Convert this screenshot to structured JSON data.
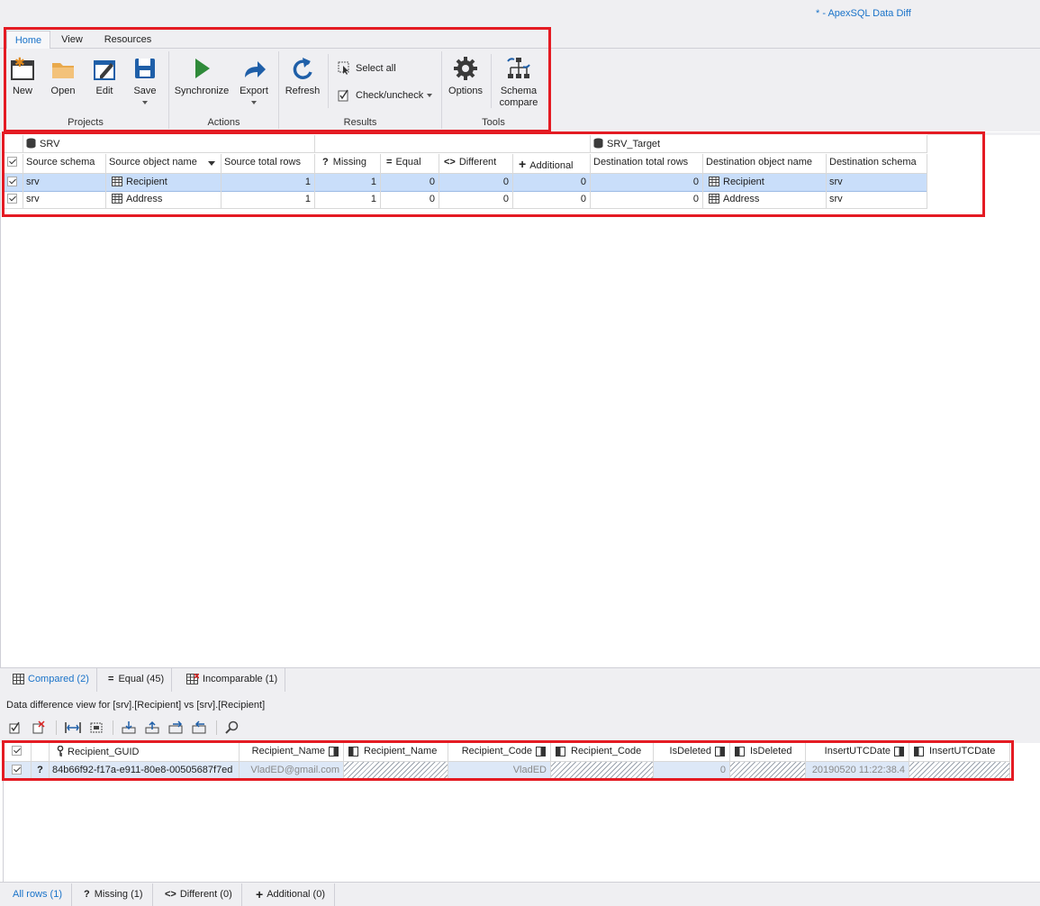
{
  "app": {
    "title": "* - ApexSQL Data Diff"
  },
  "ribbon": {
    "tabs": [
      "Home",
      "View",
      "Resources"
    ],
    "buttons": {
      "new": "New",
      "open": "Open",
      "edit": "Edit",
      "save": "Save",
      "synchronize": "Synchronize",
      "export": "Export",
      "refresh": "Refresh",
      "select_all": "Select all",
      "check_uncheck": "Check/uncheck",
      "options": "Options",
      "schema_compare_1": "Schema",
      "schema_compare_2": "compare"
    },
    "groups": {
      "projects": "Projects",
      "actions": "Actions",
      "results": "Results",
      "tools": "Tools"
    }
  },
  "results_grid": {
    "source_db": "SRV",
    "target_db": "SRV_Target",
    "headers": {
      "source_schema": "Source schema",
      "source_object_name": "Source object name",
      "source_total_rows": "Source total rows",
      "missing": "Missing",
      "equal": "Equal",
      "different": "Different",
      "additional": "Additional",
      "destination_total_rows": "Destination total rows",
      "destination_object_name": "Destination object name",
      "destination_schema": "Destination schema"
    },
    "rows": [
      {
        "source_schema": "srv",
        "source_object": "Recipient",
        "source_total": "1",
        "missing": "1",
        "equal": "0",
        "different": "0",
        "additional": "0",
        "dest_total": "0",
        "dest_object": "Recipient",
        "dest_schema": "srv"
      },
      {
        "source_schema": "srv",
        "source_object": "Address",
        "source_total": "1",
        "missing": "1",
        "equal": "0",
        "different": "0",
        "additional": "0",
        "dest_total": "0",
        "dest_object": "Address",
        "dest_schema": "srv"
      }
    ]
  },
  "result_tabs": {
    "compared": "Compared (2)",
    "equal": "Equal (45)",
    "incomparable": "Incomparable (1)"
  },
  "data_diff": {
    "caption": "Data difference view for [srv].[Recipient] vs [srv].[Recipient]",
    "headers": {
      "guid": "Recipient_GUID",
      "name_src": "Recipient_Name",
      "name_dst": "Recipient_Name",
      "code_src": "Recipient_Code",
      "code_dst": "Recipient_Code",
      "deleted_src": "IsDeleted",
      "deleted_dst": "IsDeleted",
      "date_src": "InsertUTCDate",
      "date_dst": "InsertUTCDate"
    },
    "row": {
      "status": "?",
      "guid": "84b66f92-f17a-e911-80e8-00505687f7ed",
      "name_src": "VladED@gmail.com",
      "code_src": "VladED",
      "deleted_src": "0",
      "date_src": "20190520 11:22:38.4"
    }
  },
  "status_tabs": {
    "all_rows": "All rows (1)",
    "missing": "Missing (1)",
    "different": "Different (0)",
    "additional": "Additional (0)"
  }
}
